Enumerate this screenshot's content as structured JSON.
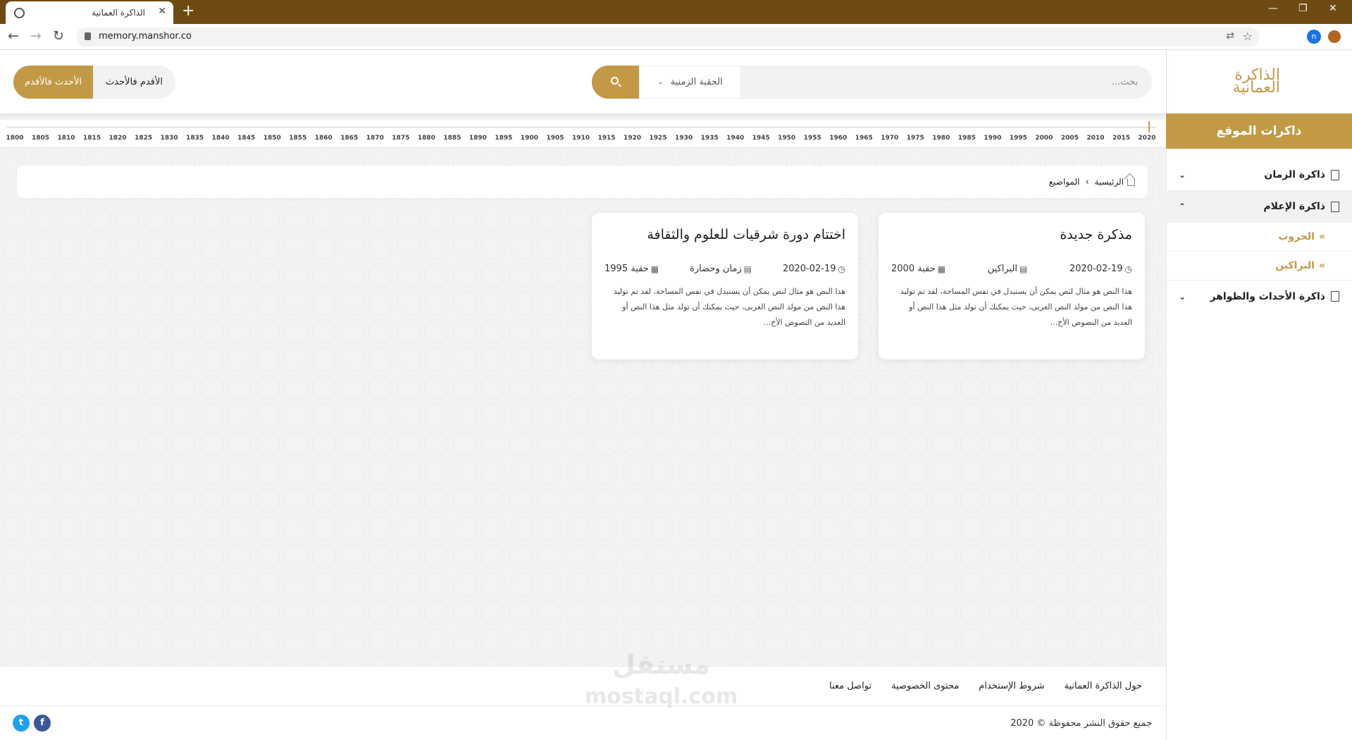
{
  "browser": {
    "tab_title": "الذاكرة العمانية",
    "url": "memory.manshor.co",
    "profile_initial": "n"
  },
  "site": {
    "logo_text": "الذاكرة العمانية",
    "sidebar_title": "ذاكرات الموقع",
    "menu": [
      {
        "label": "ذاكرة الزمان",
        "expanded": false
      },
      {
        "label": "ذاكرة الإعلام",
        "expanded": true,
        "children": [
          "الحروب",
          "البراكين"
        ]
      },
      {
        "label": "ذاكرة الأحداث والظواهر",
        "expanded": false
      }
    ]
  },
  "header": {
    "sort_newest": "الأحدث فالأقدم",
    "sort_oldest": "الأقدم فالأحدث",
    "era_select": "الحقبة الزمنية",
    "search_placeholder": "بحث..."
  },
  "timeline": {
    "years": [
      "2020",
      "2015",
      "2010",
      "2005",
      "2000",
      "1995",
      "1990",
      "1985",
      "1980",
      "1975",
      "1970",
      "1965",
      "1960",
      "1955",
      "1950",
      "1945",
      "1940",
      "1935",
      "1930",
      "1925",
      "1920",
      "1915",
      "1910",
      "1905",
      "1900",
      "1895",
      "1890",
      "1885",
      "1880",
      "1875",
      "1870",
      "1865",
      "1860",
      "1855",
      "1850",
      "1845",
      "1840",
      "1835",
      "1830",
      "1825",
      "1820",
      "1815",
      "1810",
      "1805",
      "1800"
    ]
  },
  "breadcrumb": {
    "home": "الرئيسية",
    "current": "المواضيع"
  },
  "cards": [
    {
      "title": "مذكرة جديدة",
      "date": "2020-02-19",
      "category": "البراكين",
      "era": "حقبة 2000",
      "excerpt": "هذا النص هو مثال لنص يمكن أن يستبدل في نفس المساحة، لقد تم توليد هذا النص من مولد النص العربى، حيث يمكنك أن تولد مثل هذا النص أو العديد من النصوص الأخ..."
    },
    {
      "title": "اختتام دورة شرقيات للعلوم والثقافة",
      "date": "2020-02-19",
      "category": "زمان وحضارة",
      "era": "حقبة 1995",
      "excerpt": "هذا النص هو مثال لنص يمكن أن يستبدل في نفس المساحة، لقد تم توليد هذا النص من مولد النص العربى، حيث يمكنك أن تولد مثل هذا النص أو العديد من النصوص الأخ..."
    }
  ],
  "footer": {
    "links": [
      "حول الذاكرة العمانية",
      "شروط الإستخدام",
      "محتوى الخصوصية",
      "تواصل معنا"
    ],
    "copyright": "جميع حقوق النشر محفوظة © 2020"
  },
  "watermark": {
    "line1": "مستقل",
    "line2": "mostaql.com"
  },
  "colors": {
    "accent": "#c29a45",
    "chrome": "#6e4a12",
    "facebook": "#3b5998",
    "twitter": "#1da1f2"
  }
}
